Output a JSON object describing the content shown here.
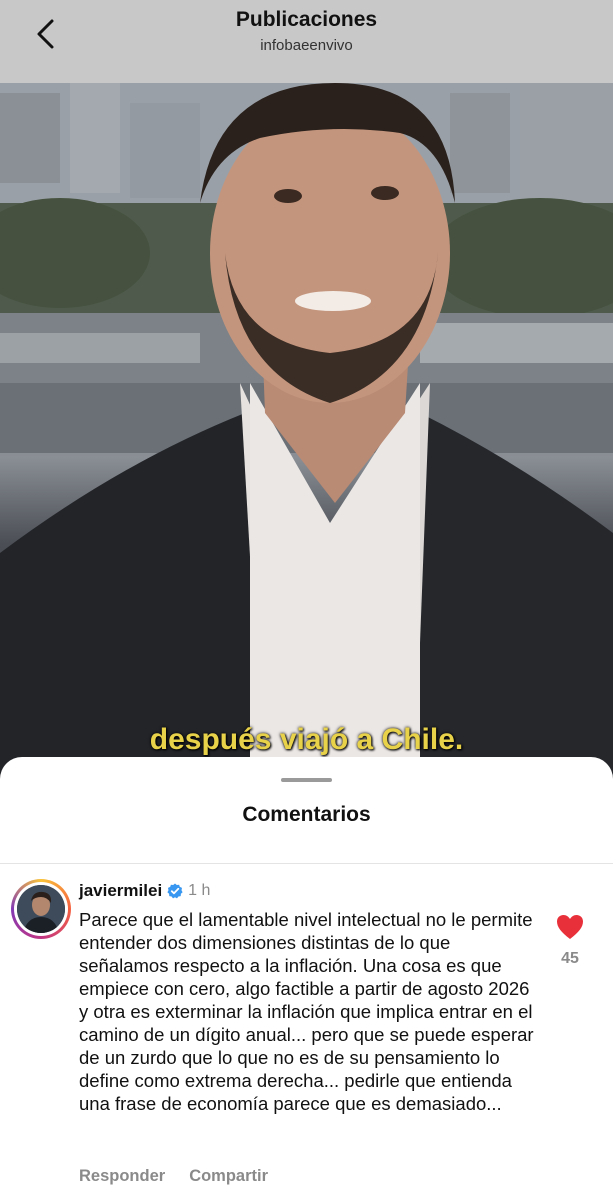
{
  "header": {
    "title": "Publicaciones",
    "subtitle": "infobaeenvivo",
    "back_icon": "chevron-left-icon"
  },
  "video": {
    "caption": "después viajó a Chile.",
    "caption_color": "#e8d24a"
  },
  "comments_sheet": {
    "title": "Comentarios",
    "comment": {
      "username": "javiermilei",
      "verified_icon": "verified-badge-icon",
      "time": "1 h",
      "text": "Parece que el lamentable nivel intelectual no le permite entender dos dimensiones distintas de lo que señalamos respecto a la inflación. Una cosa es que empiece con cero, algo factible a partir de agosto 2026 y otra es exterminar la inflación que implica entrar en el camino de un dígito anual... pero que se puede esperar de un zurdo que lo que no es de su pensamiento lo define como extrema derecha... pedirle que entienda una frase de economía parece que es demasiado...",
      "like_icon": "heart-filled-icon",
      "like_color": "#e8303a",
      "like_count": "45",
      "reply_label": "Responder",
      "share_label": "Compartir"
    }
  }
}
